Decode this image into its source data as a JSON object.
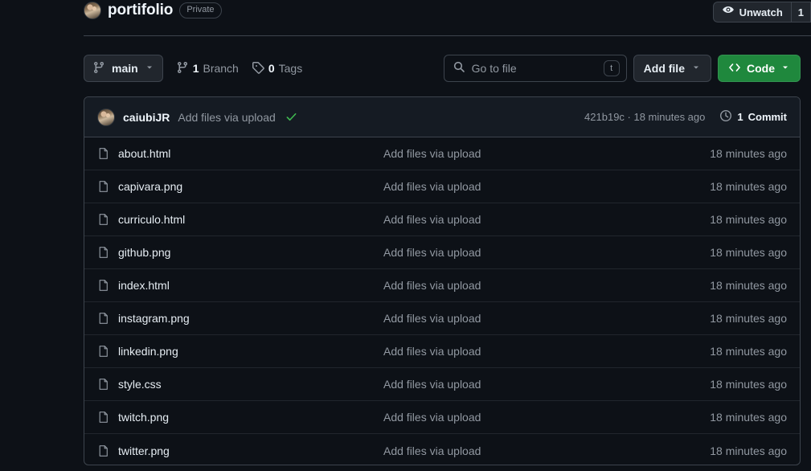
{
  "header": {
    "owner_avatar": "owner-avatar",
    "repo_name": "portifolio",
    "visibility": "Private",
    "watch_label": "Unwatch",
    "watch_count": "1",
    "eye_icon": "eye-icon"
  },
  "toolbar": {
    "branch_name": "main",
    "branch_icon": "branch-icon",
    "chevron_icon": "chevron-down-icon",
    "branch_count": "1",
    "branch_count_label": "Branch",
    "tag_count": "0",
    "tag_count_label": "Tags",
    "tag_icon": "tag-icon",
    "search_placeholder": "Go to file",
    "search_value": "",
    "search_icon": "search-icon",
    "search_kbd": "t",
    "add_file_label": "Add file",
    "code_label": "Code",
    "code_icon": "code-brackets-icon"
  },
  "commit_bar": {
    "avatar": "commit-author-avatar",
    "author": "caiubiJR",
    "message": "Add files via upload",
    "status_icon": "check-success-icon",
    "hash_and_time": "421b19c · 18 minutes ago",
    "history_icon": "history-icon",
    "commits_count": "1",
    "commits_label": "Commit"
  },
  "files": [
    {
      "icon": "file-icon",
      "name": "about.html",
      "commit": "Add files via upload",
      "time": "18 minutes ago"
    },
    {
      "icon": "file-icon",
      "name": "capivara.png",
      "commit": "Add files via upload",
      "time": "18 minutes ago"
    },
    {
      "icon": "file-icon",
      "name": "curriculo.html",
      "commit": "Add files via upload",
      "time": "18 minutes ago"
    },
    {
      "icon": "file-icon",
      "name": "github.png",
      "commit": "Add files via upload",
      "time": "18 minutes ago"
    },
    {
      "icon": "file-icon",
      "name": "index.html",
      "commit": "Add files via upload",
      "time": "18 minutes ago"
    },
    {
      "icon": "file-icon",
      "name": "instagram.png",
      "commit": "Add files via upload",
      "time": "18 minutes ago"
    },
    {
      "icon": "file-icon",
      "name": "linkedin.png",
      "commit": "Add files via upload",
      "time": "18 minutes ago"
    },
    {
      "icon": "file-icon",
      "name": "style.css",
      "commit": "Add files via upload",
      "time": "18 minutes ago"
    },
    {
      "icon": "file-icon",
      "name": "twitch.png",
      "commit": "Add files via upload",
      "time": "18 minutes ago"
    },
    {
      "icon": "file-icon",
      "name": "twitter.png",
      "commit": "Add files via upload",
      "time": "18 minutes ago"
    }
  ],
  "colors": {
    "background": "#0d1117",
    "border": "#3d444d",
    "text_primary": "#e6edf3",
    "text_muted": "#9198a1",
    "accent_green": "#1f883d",
    "success_check": "#3fb950",
    "header_row_bg": "#151b23"
  }
}
